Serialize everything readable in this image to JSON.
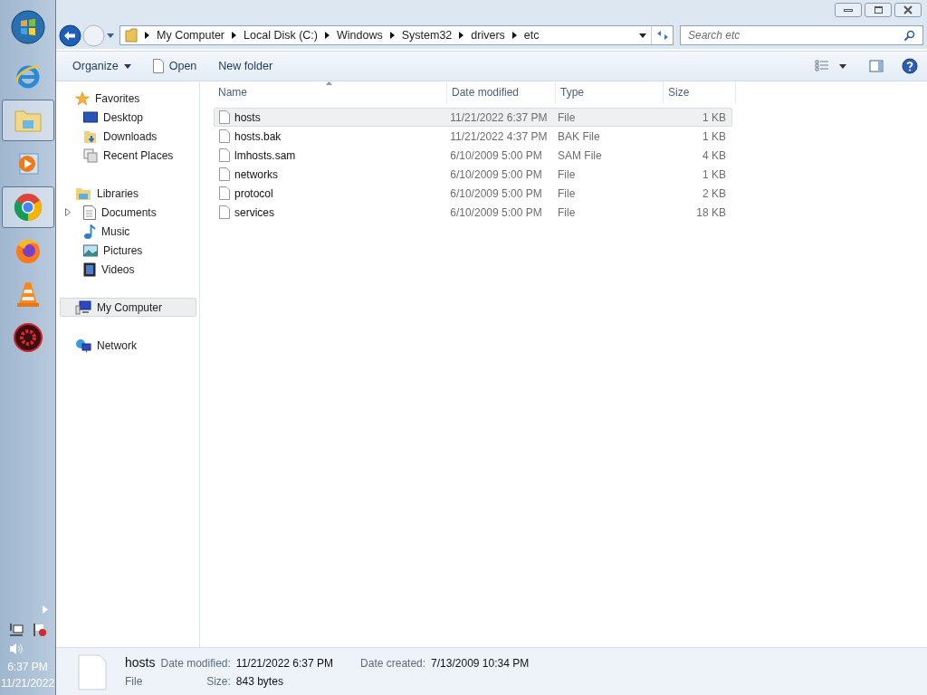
{
  "taskbar": {
    "apps": [
      {
        "kind": "start",
        "active": false
      },
      {
        "kind": "ie",
        "active": false
      },
      {
        "kind": "explorer",
        "active": true
      },
      {
        "kind": "media",
        "active": false
      },
      {
        "kind": "chrome",
        "active": true
      },
      {
        "kind": "firefox",
        "active": false
      },
      {
        "kind": "vlc",
        "active": false
      },
      {
        "kind": "gear",
        "active": false
      }
    ],
    "time": "6:37 PM",
    "date": "11/21/2022"
  },
  "address": {
    "crumbs": [
      "My Computer",
      "Local Disk (C:)",
      "Windows",
      "System32",
      "drivers",
      "etc"
    ]
  },
  "search": {
    "placeholder": "Search etc"
  },
  "toolbar": {
    "buttons": [
      {
        "kind": "menu",
        "label": "Organize"
      },
      {
        "kind": "file",
        "label": "Open"
      },
      {
        "kind": "plain",
        "label": "New folder"
      }
    ]
  },
  "nav": [
    {
      "label": "Favorites",
      "kind": "star",
      "selected": false,
      "children": [
        {
          "label": "Desktop",
          "kind": "desktop",
          "expandable": false
        },
        {
          "label": "Downloads",
          "kind": "downloads",
          "expandable": false
        },
        {
          "label": "Recent Places",
          "kind": "recent",
          "expandable": false
        }
      ]
    },
    {
      "label": "Libraries",
      "kind": "libraries",
      "selected": false,
      "children": [
        {
          "label": "Documents",
          "kind": "documents",
          "expandable": true
        },
        {
          "label": "Music",
          "kind": "music",
          "expandable": false
        },
        {
          "label": "Pictures",
          "kind": "pictures",
          "expandable": false
        },
        {
          "label": "Videos",
          "kind": "videos",
          "expandable": false
        }
      ]
    },
    {
      "label": "My Computer",
      "kind": "computer",
      "selected": true
    },
    {
      "label": "Network",
      "kind": "network",
      "selected": false
    }
  ],
  "table": {
    "columns": [
      "Name",
      "Date modified",
      "Type",
      "Size"
    ],
    "rows": [
      {
        "name": "hosts",
        "date": "11/21/2022 6:37 PM",
        "type": "File",
        "size": "1 KB",
        "selected": true
      },
      {
        "name": "hosts.bak",
        "date": "11/21/2022 4:37 PM",
        "type": "BAK File",
        "size": "1 KB",
        "selected": false
      },
      {
        "name": "lmhosts.sam",
        "date": "6/10/2009 5:00 PM",
        "type": "SAM File",
        "size": "4 KB",
        "selected": false
      },
      {
        "name": "networks",
        "date": "6/10/2009 5:00 PM",
        "type": "File",
        "size": "1 KB",
        "selected": false
      },
      {
        "name": "protocol",
        "date": "6/10/2009 5:00 PM",
        "type": "File",
        "size": "2 KB",
        "selected": false
      },
      {
        "name": "services",
        "date": "6/10/2009 5:00 PM",
        "type": "File",
        "size": "18 KB",
        "selected": false
      }
    ]
  },
  "details": {
    "name": "hosts",
    "type": "File",
    "fields": [
      {
        "label": "Date modified:",
        "value": "11/21/2022 6:37 PM"
      },
      {
        "label": "Size:",
        "value": "843 bytes"
      },
      {
        "label": "Date created:",
        "value": "7/13/2009 10:34 PM"
      }
    ]
  }
}
